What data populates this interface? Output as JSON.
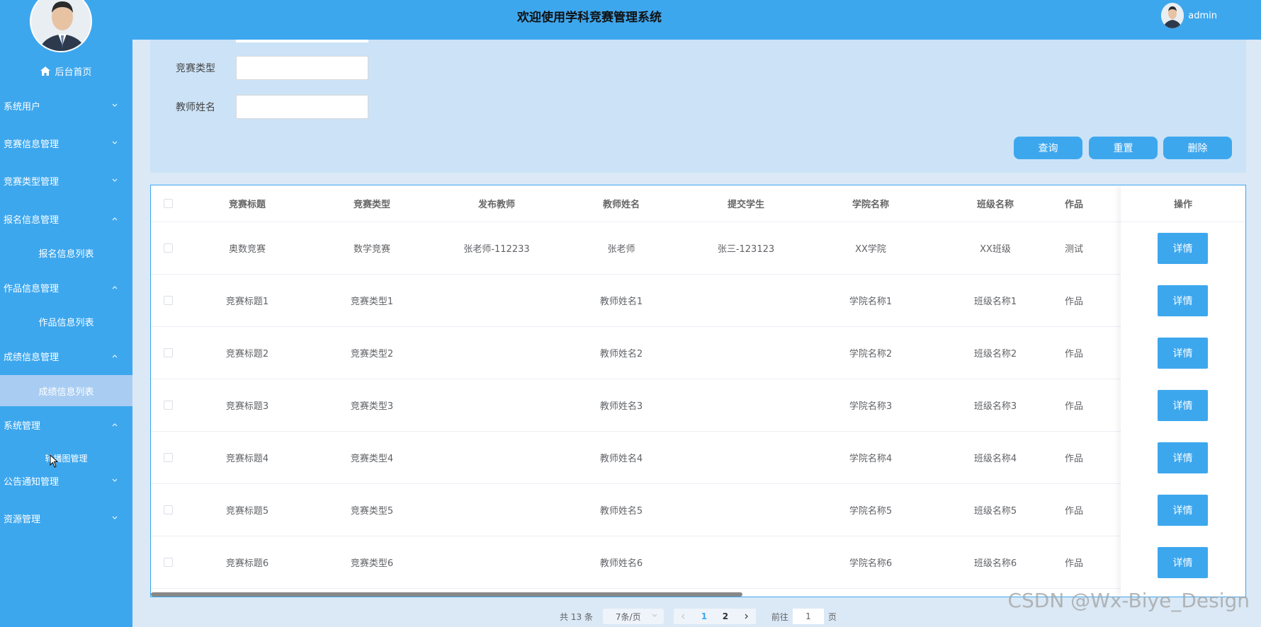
{
  "header": {
    "title": "欢迎使用学科竞赛管理系统",
    "username": "admin"
  },
  "sidebar": {
    "home_label": "后台首页",
    "menus": [
      {
        "label": "系统用户",
        "expanded": false
      },
      {
        "label": "竞赛信息管理",
        "expanded": false
      },
      {
        "label": "竞赛类型管理",
        "expanded": false
      },
      {
        "label": "报名信息管理",
        "expanded": true,
        "sub": "报名信息列表"
      },
      {
        "label": "作品信息管理",
        "expanded": true,
        "sub": "作品信息列表"
      },
      {
        "label": "成绩信息管理",
        "expanded": true,
        "sub": "成绩信息列表"
      },
      {
        "label": "系统管理",
        "expanded": true,
        "sub": "轮播图管理"
      },
      {
        "label": "公告通知管理",
        "expanded": false
      },
      {
        "label": "资源管理",
        "expanded": false
      }
    ]
  },
  "search": {
    "fields": [
      {
        "label": "竞赛类型",
        "value": ""
      },
      {
        "label": "教师姓名",
        "value": ""
      }
    ],
    "buttons": {
      "query": "查询",
      "reset": "重置",
      "delete": "删除"
    }
  },
  "table": {
    "headers": [
      "竞赛标题",
      "竞赛类型",
      "发布教师",
      "教师姓名",
      "提交学生",
      "学院名称",
      "班级名称",
      "作品"
    ],
    "op_header": "操作",
    "detail_label": "详情",
    "rows": [
      [
        "奥数竞赛",
        "数学竞赛",
        "张老师-112233",
        "张老师",
        "张三-123123",
        "XX学院",
        "XX班级",
        "测试"
      ],
      [
        "竞赛标题1",
        "竞赛类型1",
        "",
        "教师姓名1",
        "",
        "学院名称1",
        "班级名称1",
        "作品"
      ],
      [
        "竞赛标题2",
        "竞赛类型2",
        "",
        "教师姓名2",
        "",
        "学院名称2",
        "班级名称2",
        "作品"
      ],
      [
        "竞赛标题3",
        "竞赛类型3",
        "",
        "教师姓名3",
        "",
        "学院名称3",
        "班级名称3",
        "作品"
      ],
      [
        "竞赛标题4",
        "竞赛类型4",
        "",
        "教师姓名4",
        "",
        "学院名称4",
        "班级名称4",
        "作品"
      ],
      [
        "竞赛标题5",
        "竞赛类型5",
        "",
        "教师姓名5",
        "",
        "学院名称5",
        "班级名称5",
        "作品"
      ],
      [
        "竞赛标题6",
        "竞赛类型6",
        "",
        "教师姓名6",
        "",
        "学院名称6",
        "班级名称6",
        "作品"
      ]
    ]
  },
  "pagination": {
    "total_text": "共 13 条",
    "page_size": "7条/页",
    "pages": [
      "1",
      "2"
    ],
    "current_page": "1",
    "goto_prefix": "前往",
    "goto_value": "1",
    "goto_suffix": "页"
  },
  "watermark": "CSDN @Wx-Biye_Design",
  "colors": {
    "primary": "#3da7ee",
    "panel": "#cce3f7",
    "active_sub": "#a9cdf2"
  }
}
